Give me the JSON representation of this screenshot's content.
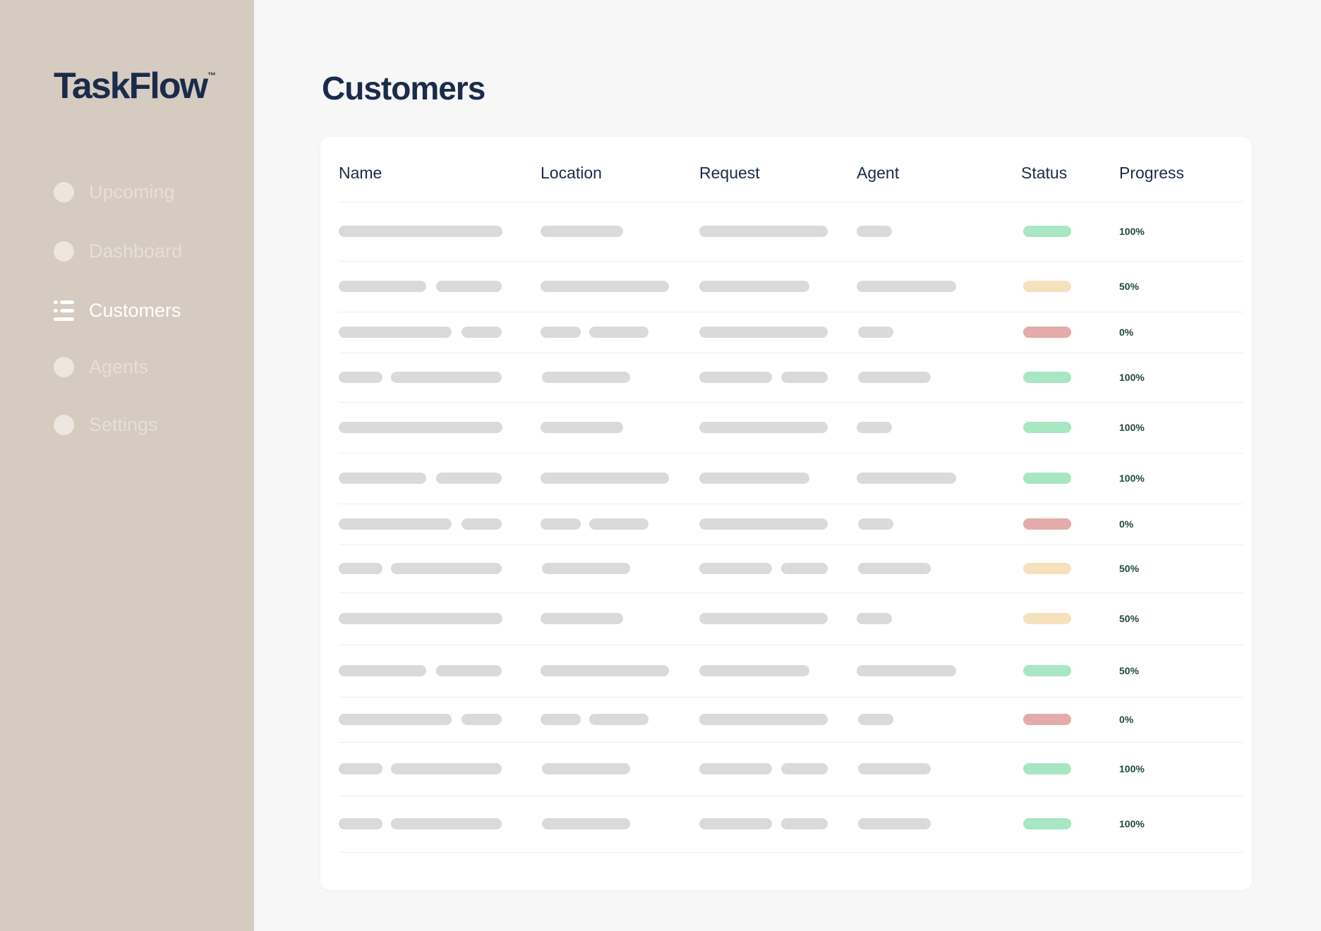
{
  "app": {
    "logo": "TaskFlow",
    "logo_tm": "™"
  },
  "sidebar": {
    "items": [
      {
        "label": "Upcoming",
        "icon": "circle-icon",
        "active": false
      },
      {
        "label": "Dashboard",
        "icon": "circle-icon",
        "active": false
      },
      {
        "label": "Customers",
        "icon": "list-icon",
        "active": true
      },
      {
        "label": "Agents",
        "icon": "circle-icon",
        "active": false
      },
      {
        "label": "Settings",
        "icon": "circle-icon",
        "active": false
      }
    ]
  },
  "main": {
    "title": "Customers",
    "table": {
      "columns": [
        "Name",
        "Location",
        "Request",
        "Agent",
        "Status",
        "Progress"
      ],
      "rows": [
        {
          "status": "complete",
          "progress": "100%"
        },
        {
          "status": "in-progress",
          "progress": "50%"
        },
        {
          "status": "blocked",
          "progress": "0%"
        },
        {
          "status": "complete",
          "progress": "100%"
        },
        {
          "status": "complete",
          "progress": "100%"
        },
        {
          "status": "complete",
          "progress": "100%"
        },
        {
          "status": "blocked",
          "progress": "0%"
        },
        {
          "status": "in-progress",
          "progress": "50%"
        },
        {
          "status": "in-progress",
          "progress": "50%"
        },
        {
          "status": "complete",
          "progress": "50%"
        },
        {
          "status": "blocked",
          "progress": "0%"
        },
        {
          "status": "complete",
          "progress": "100%"
        },
        {
          "status": "complete",
          "progress": "100%"
        }
      ]
    }
  },
  "colors": {
    "sidebar_bg": "#d6cbc0",
    "brand_text": "#1b2b4a",
    "status_complete": "#a8e6c4",
    "status_in_progress": "#f5e2bd",
    "status_blocked": "#e3abaa",
    "placeholder": "#dadada"
  }
}
